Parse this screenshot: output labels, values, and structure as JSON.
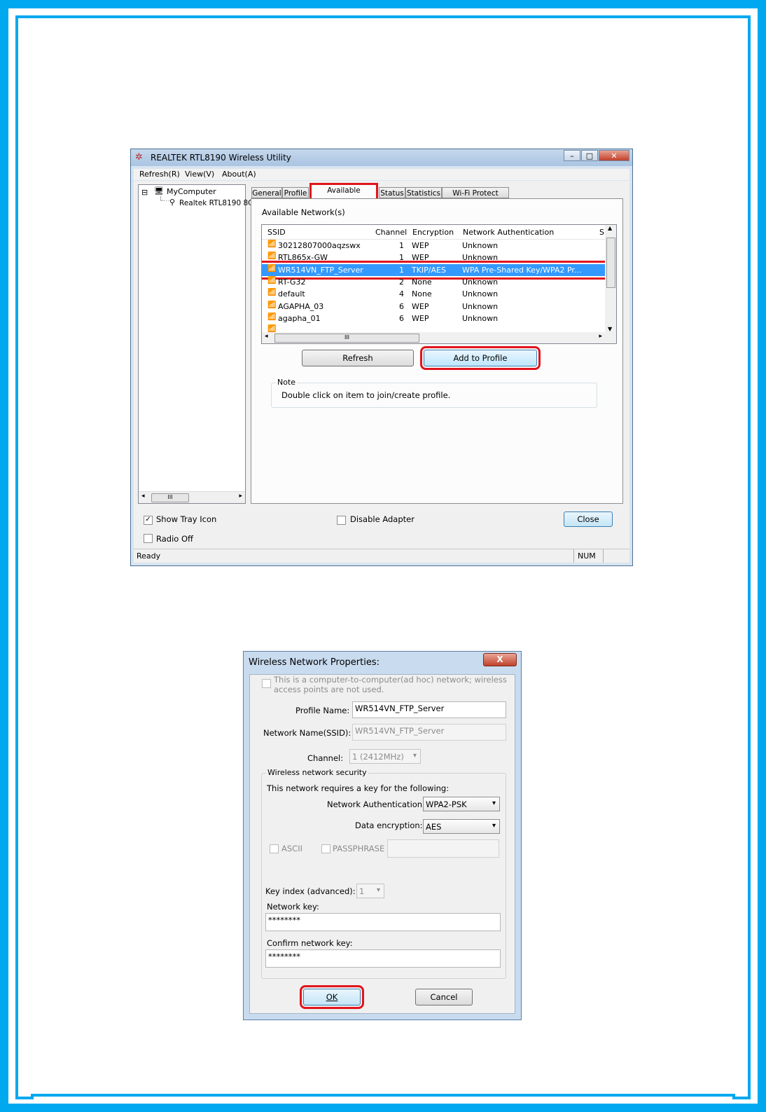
{
  "utility_window": {
    "title": "REALTEK RTL8190 Wireless Utility",
    "menu": [
      "Refresh(R)",
      "View(V)",
      "About(A)"
    ],
    "tree": {
      "root": "MyComputer",
      "child": "Realtek RTL8190 8C"
    },
    "tabs": [
      "General",
      "Profile",
      "Available Network",
      "Status",
      "Statistics",
      "Wi-Fi Protect Setup"
    ],
    "active_tab": "Available Network",
    "panel_title": "Available Network(s)",
    "columns": {
      "ssid": "SSID",
      "channel": "Channel",
      "encryption": "Encryption",
      "auth": "Network Authentication",
      "s": "S"
    },
    "networks": [
      {
        "ssid": "30212807000aqzswx",
        "channel": "1",
        "encryption": "WEP",
        "auth": "Unknown"
      },
      {
        "ssid": "RTL865x-GW",
        "channel": "1",
        "encryption": "WEP",
        "auth": "Unknown"
      },
      {
        "ssid": "WR514VN_FTP_Server",
        "channel": "1",
        "encryption": "TKIP/AES",
        "auth": "WPA Pre-Shared Key/WPA2 Pr..."
      },
      {
        "ssid": "RT-G32",
        "channel": "2",
        "encryption": "None",
        "auth": "Unknown"
      },
      {
        "ssid": "default",
        "channel": "4",
        "encryption": "None",
        "auth": "Unknown"
      },
      {
        "ssid": "AGAPHA_03",
        "channel": "6",
        "encryption": "WEP",
        "auth": "Unknown"
      },
      {
        "ssid": "agapha_01",
        "channel": "6",
        "encryption": "WEP",
        "auth": "Unknown"
      },
      {
        "ssid": "",
        "channel": "",
        "encryption": "",
        "auth": ""
      }
    ],
    "selected_ssid": "WR514VN_FTP_Server",
    "scroll_glyph": "III",
    "refresh_button": "Refresh",
    "add_profile_button": "Add to Profile",
    "note_title": "Note",
    "note_text": "Double click on item to join/create profile.",
    "show_tray_icon": {
      "label": "Show Tray Icon",
      "checked": true
    },
    "radio_off": {
      "label": "Radio Off",
      "checked": false
    },
    "disable_adapter": {
      "label": "Disable Adapter",
      "checked": false
    },
    "close_button": "Close",
    "status_text": "Ready",
    "status_num": "NUM"
  },
  "properties_dialog": {
    "title": "Wireless Network Properties:",
    "close_glyph": "X",
    "adhoc_line1": "This is a computer-to-computer(ad hoc) network; wireless",
    "adhoc_line2": "access points are not used.",
    "profile_name_label": "Profile Name:",
    "profile_name_value": "WR514VN_FTP_Server",
    "ssid_label": "Network Name(SSID):",
    "ssid_value": "WR514VN_FTP_Server",
    "channel_label": "Channel:",
    "channel_value": "1 (2412MHz)",
    "security_group": "Wireless network security",
    "requires_key_text": "This network requires a key for the following:",
    "auth_label": "Network Authentication:",
    "auth_value": "WPA2-PSK",
    "encryption_label": "Data encryption:",
    "encryption_value": "AES",
    "ascii_label": "ASCII",
    "passphrase_label": "PASSPHRASE",
    "key_index_label": "Key index (advanced):",
    "key_index_value": "1",
    "network_key_label": "Network key:",
    "network_key_value": "********",
    "confirm_key_label": "Confirm network key:",
    "confirm_key_value": "********",
    "ok_button": "OK",
    "cancel_button": "Cancel"
  },
  "colors": {
    "frame": "#00a8f0",
    "highlight": "#e0151b",
    "selection": "#3399ff"
  }
}
